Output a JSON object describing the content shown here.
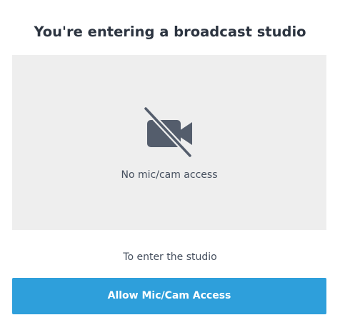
{
  "dialog": {
    "title": "You're entering a broadcast studio"
  },
  "preview": {
    "icon": "camera-off-icon",
    "message": "No mic/cam access"
  },
  "instructions": {
    "text": "To enter the studio"
  },
  "actions": {
    "allow_label": "Allow Mic/Cam Access"
  },
  "colors": {
    "accent": "#2e9fdb",
    "preview_bg": "#eeeeee",
    "icon": "#545d6c",
    "title": "#2c3440"
  }
}
